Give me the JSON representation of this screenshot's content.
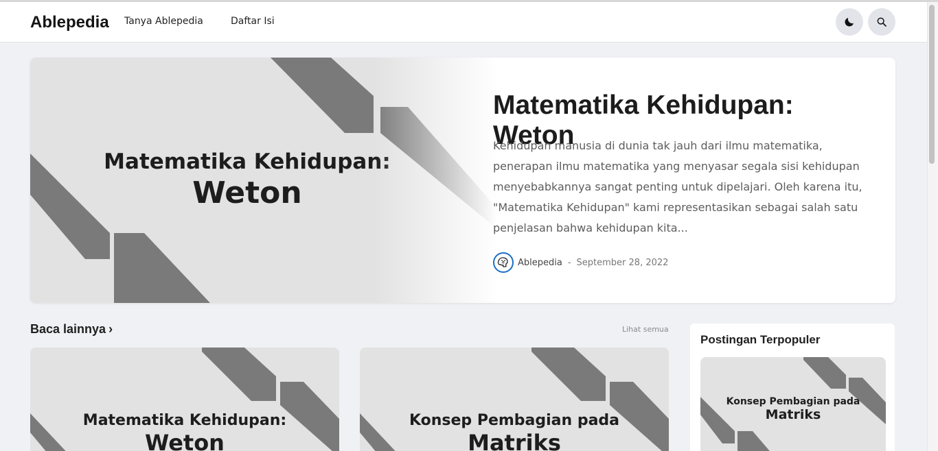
{
  "header": {
    "brand": "Ablepedia",
    "nav": [
      "Tanya Ablepedia",
      "Daftar Isi"
    ],
    "icons": [
      "moon-icon",
      "search-icon"
    ]
  },
  "hero": {
    "image_title_line1": "Matematika Kehidupan:",
    "image_title_line2": "Weton",
    "title": "Matematika Kehidupan: Weton",
    "excerpt": "Kehidupan manusia di dunia tak jauh dari ilmu matematika, penerapan ilmu matematika yang menyasar segala sisi kehidupan menyebabkannya sangat penting untuk dipelajari. Oleh karena itu, \"Matematika Kehidupan\" kami representasikan sebagai salah satu penjelasan bahwa kehidupan kita...",
    "author": "Ablepedia",
    "separator": "-",
    "date": "September 28, 2022"
  },
  "more": {
    "title": "Baca lainnya",
    "chevron": "›",
    "see_all": "Lihat semua",
    "cards": [
      {
        "line1": "Matematika Kehidupan:",
        "line2": "Weton"
      },
      {
        "line1": "Konsep Pembagian pada",
        "line2": "Matriks"
      }
    ]
  },
  "sidebar": {
    "title": "Postingan Terpopuler",
    "thumb_line1": "Konsep Pembagian pada",
    "thumb_line2": "Matriks"
  },
  "colors": {
    "background": "#f0f1f5",
    "thumb_background": "#e2e2e2",
    "stripe": "#7a7a7a",
    "avatar_ring": "#1e6fc4"
  }
}
